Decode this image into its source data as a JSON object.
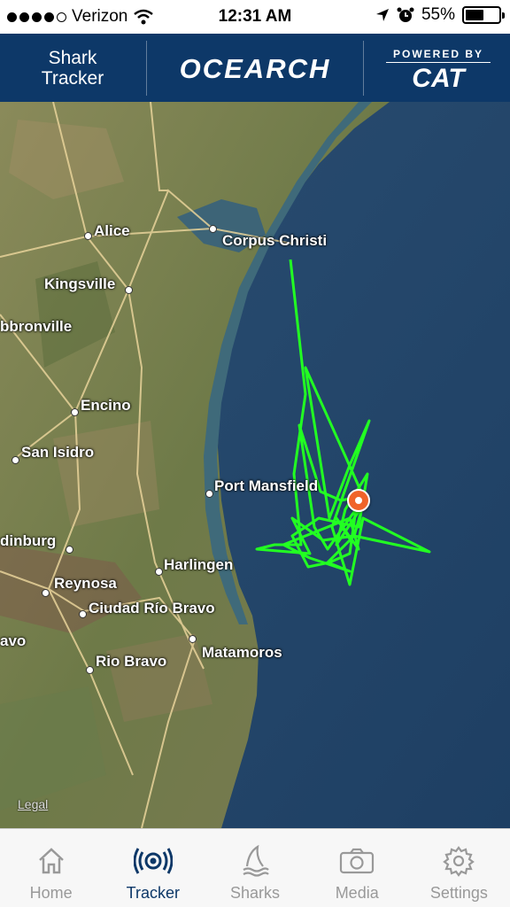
{
  "status_bar": {
    "carrier": "Verizon",
    "time": "12:31 AM",
    "battery": "55%",
    "battery_level": 0.55
  },
  "header": {
    "app_title_line1": "Shark",
    "app_title_line2": "Tracker",
    "brand": "OCEARCH",
    "powered_by": "POWERED BY",
    "sponsor": "CAT",
    "background": "#0d3868"
  },
  "map": {
    "cities": [
      {
        "name": "Alice"
      },
      {
        "name": "Corpus Christi"
      },
      {
        "name": "Kingsville"
      },
      {
        "name": "bbronville"
      },
      {
        "name": "Encino"
      },
      {
        "name": "San Isidro"
      },
      {
        "name": "Port Mansfield"
      },
      {
        "name": "dinburg"
      },
      {
        "name": "Harlingen"
      },
      {
        "name": "Reynosa"
      },
      {
        "name": "Ciudad Río Bravo"
      },
      {
        "name": "avo"
      },
      {
        "name": "Rio Bravo"
      },
      {
        "name": "Matamoros"
      }
    ],
    "legal": "Legal",
    "track_color": "#22ff22",
    "pin_color": "#f0642a"
  },
  "tabs": [
    {
      "label": "Home",
      "icon": "home-icon"
    },
    {
      "label": "Tracker",
      "icon": "tracker-icon",
      "active": true
    },
    {
      "label": "Sharks",
      "icon": "shark-fin-icon"
    },
    {
      "label": "Media",
      "icon": "camera-icon"
    },
    {
      "label": "Settings",
      "icon": "gear-icon"
    }
  ]
}
